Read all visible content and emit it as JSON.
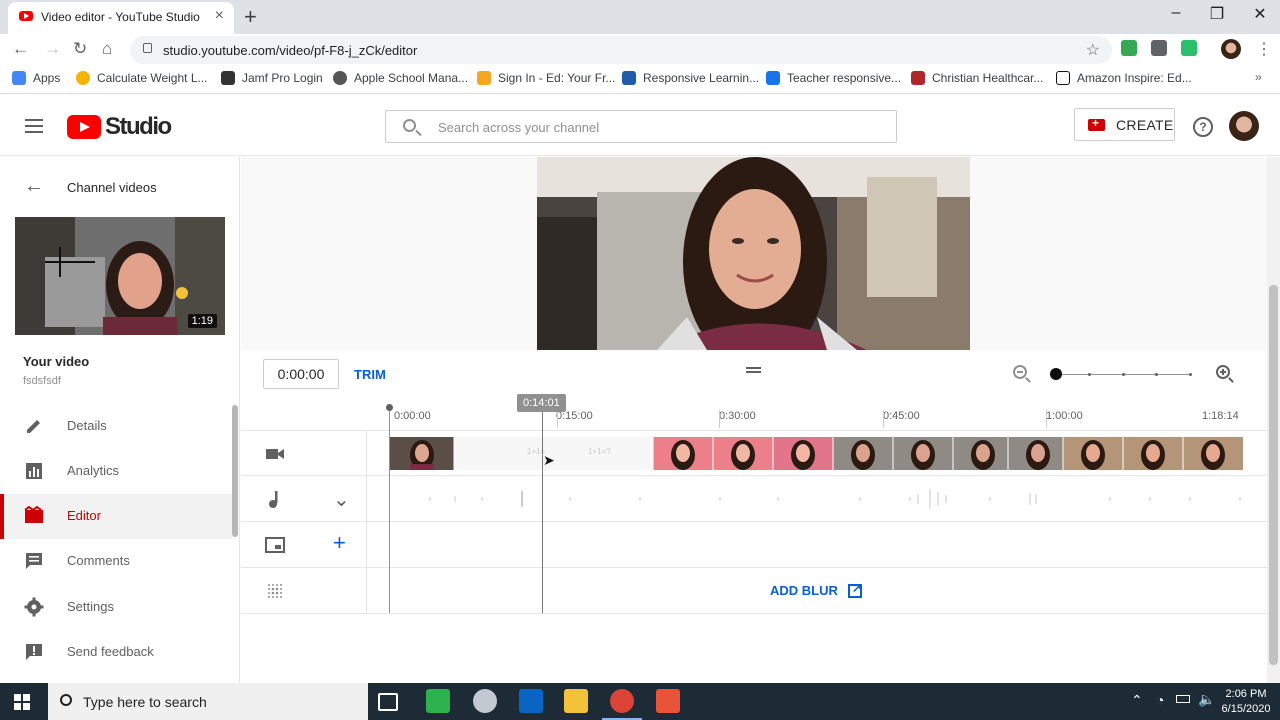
{
  "browser": {
    "tab_title": "Video editor - YouTube Studio",
    "url": "studio.youtube.com/video/pf-F8-j_zCk/editor",
    "bookmarks": [
      {
        "label": "Apps",
        "icon": "apps-grid-icon",
        "color": "#4285f4"
      },
      {
        "label": "Calculate Weight L...",
        "icon": "calc-icon",
        "color": "#f4b400"
      },
      {
        "label": "Jamf Pro Login",
        "icon": "jamf-icon",
        "color": "#333333"
      },
      {
        "label": "Apple School Mana...",
        "icon": "apple-icon",
        "color": "#555555"
      },
      {
        "label": "Sign In - Ed: Your Fr...",
        "icon": "shield-icon",
        "color": "#f5a623"
      },
      {
        "label": "Responsive Learnin...",
        "icon": "book-icon",
        "color": "#1f5ba8"
      },
      {
        "label": "Teacher responsive...",
        "icon": "rl-icon",
        "color": "#1a73e8"
      },
      {
        "label": "Christian Healthcar...",
        "icon": "chm-icon",
        "color": "#b0272b"
      },
      {
        "label": "Amazon Inspire: Ed...",
        "icon": "amazon-icon",
        "color": "#111111"
      }
    ]
  },
  "header": {
    "logo_text": "Studio",
    "search_placeholder": "Search across your channel",
    "create_label": "CREATE",
    "help_label": "?"
  },
  "sidebar": {
    "back_label": "Channel videos",
    "thumb_duration": "1:19",
    "your_video_label": "Your video",
    "video_title": "fsdsfsdf",
    "items": [
      {
        "label": "Details",
        "icon": "pencil-icon"
      },
      {
        "label": "Analytics",
        "icon": "analytics-icon"
      },
      {
        "label": "Editor",
        "icon": "editor-icon",
        "active": true
      },
      {
        "label": "Comments",
        "icon": "comments-icon"
      },
      {
        "label": "Settings",
        "icon": "gear-icon"
      },
      {
        "label": "Send feedback",
        "icon": "feedback-icon"
      }
    ]
  },
  "editor": {
    "time_value": "0:00:00",
    "trim_label": "TRIM",
    "playhead_time": "0:14:01",
    "ruler_ticks": [
      "0:00:00",
      "0:15:00",
      "0:30:00",
      "0:45:00",
      "1:00:00",
      "1:18:14"
    ],
    "add_blur_label": "ADD BLUR",
    "zoom_level_fraction": 0.0
  },
  "taskbar": {
    "search_placeholder": "Type here to search",
    "time": "2:06 PM",
    "date": "6/15/2020"
  }
}
